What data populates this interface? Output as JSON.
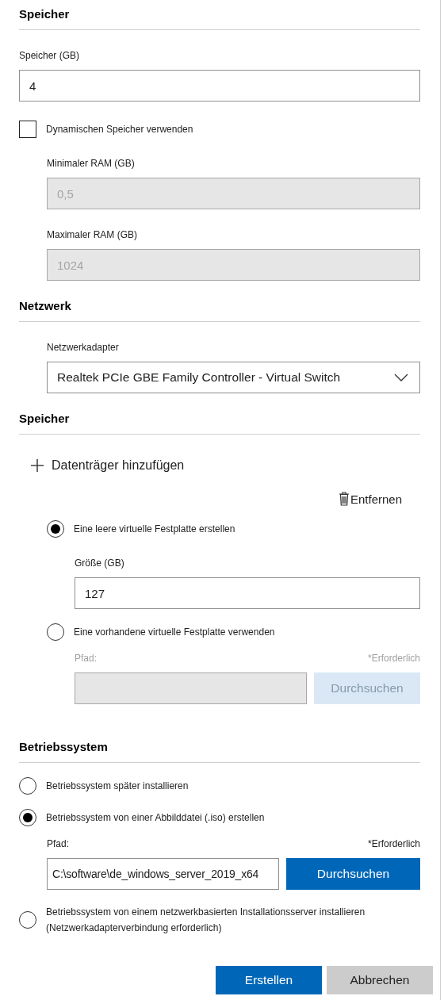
{
  "sections": [
    {
      "kind": "plain",
      "title": "Speicher",
      "items": [
        {
          "kind": "field",
          "label": "Speicher (GB)",
          "value": "4",
          "disabled": false
        },
        {
          "kind": "checkbox",
          "label": "Dynamischen Speicher verwenden",
          "checked": false,
          "children": [
            {
              "kind": "field",
              "label": "Minimaler RAM (GB)",
              "value": "0,5",
              "disabled": true
            },
            {
              "kind": "field",
              "label": "Maximaler RAM (GB)",
              "value": "1024",
              "disabled": true
            }
          ]
        }
      ]
    },
    {
      "kind": "plain",
      "title": "Netzwerk",
      "items": [
        {
          "kind": "group",
          "children": [
            {
              "kind": "select",
              "label": "Netzwerkadapter",
              "value": "Realtek PCIe GBE Family Controller - Virtual Switch"
            }
          ]
        }
      ]
    },
    {
      "kind": "plain",
      "title": "Speicher",
      "items": [
        {
          "kind": "add",
          "label": "Datenträger hinzufügen"
        },
        {
          "kind": "group",
          "children": [
            {
              "kind": "remove",
              "label": "Entfernen"
            },
            {
              "kind": "radio",
              "label": "Eine leere virtuelle Festplatte erstellen",
              "selected": true,
              "children": [
                {
                  "kind": "field",
                  "label": "Größe (GB)",
                  "value": "127",
                  "disabled": false
                }
              ]
            },
            {
              "kind": "radio",
              "label": "Eine vorhandene virtuelle Festplatte verwenden",
              "selected": false,
              "children": [
                {
                  "kind": "path",
                  "label": "Pfad:",
                  "required": "*Erforderlich",
                  "button": "Durchsuchen",
                  "disabled": true
                }
              ]
            }
          ]
        }
      ]
    },
    {
      "kind": "plain",
      "title": "Betriebssystem",
      "items": [
        {
          "kind": "radio",
          "label": "Betriebssystem später installieren",
          "selected": false
        },
        {
          "kind": "radio",
          "label": "Betriebssystem von einer Abbilddatei (.iso) erstellen",
          "selected": true,
          "children": [
            {
              "kind": "path",
              "label": "Pfad:",
              "required": "*Erforderlich",
              "value": "C:\\software\\de_windows_server_2019_x64",
              "button": "Durchsuchen",
              "disabled": false
            }
          ]
        },
        {
          "kind": "radio",
          "label": "Betriebssystem von einem netzwerkbasierten Installationsserver installieren (Netzwerkadapterverbindung erforderlich)",
          "selected": false
        }
      ]
    }
  ],
  "buttons": [
    {
      "label": "Erstellen",
      "kind": "primary"
    },
    {
      "label": "Abbrechen",
      "kind": "secondary"
    }
  ]
}
